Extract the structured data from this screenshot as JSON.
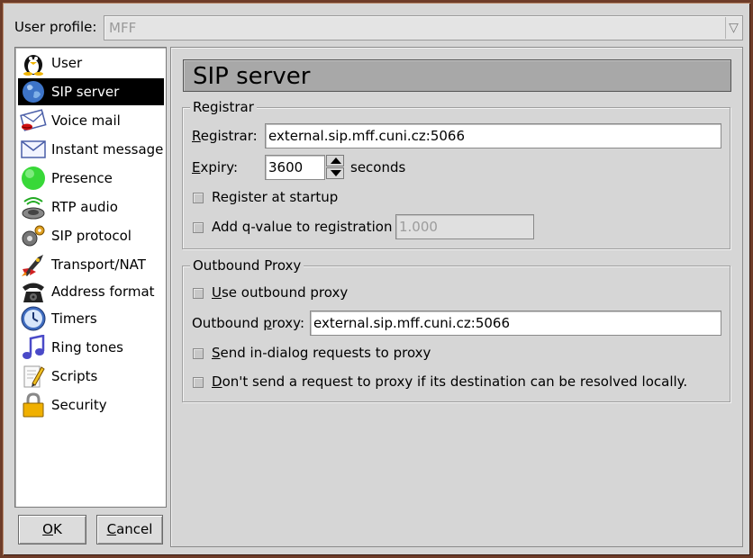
{
  "profile": {
    "label": "User profile:",
    "value": "MFF",
    "arrow": "▽"
  },
  "categories": [
    {
      "label": "User",
      "icon": "penguin-icon",
      "selected": false
    },
    {
      "label": "SIP server",
      "icon": "globe-icon",
      "selected": true
    },
    {
      "label": "Voice mail",
      "icon": "voicemail-envelope-icon",
      "selected": false
    },
    {
      "label": "Instant message",
      "icon": "envelope-icon",
      "selected": false
    },
    {
      "label": "Presence",
      "icon": "green-light-icon",
      "selected": false
    },
    {
      "label": "RTP audio",
      "icon": "speaker-icon",
      "selected": false
    },
    {
      "label": "SIP protocol",
      "icon": "gears-icon",
      "selected": false
    },
    {
      "label": "Transport/NAT",
      "icon": "rocket-icon",
      "selected": false
    },
    {
      "label": "Address format",
      "icon": "telephone-icon",
      "selected": false
    },
    {
      "label": "Timers",
      "icon": "clock-icon",
      "selected": false
    },
    {
      "label": "Ring tones",
      "icon": "music-note-icon",
      "selected": false
    },
    {
      "label": "Scripts",
      "icon": "script-pencil-icon",
      "selected": false
    },
    {
      "label": "Security",
      "icon": "padlock-icon",
      "selected": false
    }
  ],
  "buttons": {
    "ok_mnemonic": "O",
    "ok_rest": "K",
    "cancel_mnemonic": "C",
    "cancel_rest": "ancel"
  },
  "page": {
    "title": "SIP server"
  },
  "registrar_group": {
    "title": "Registrar",
    "registrar_label_mnemonic": "R",
    "registrar_label_rest": "egistrar:",
    "registrar_value": "external.sip.mff.cuni.cz:5066",
    "expiry_label_mnemonic": "E",
    "expiry_label_rest": "xpiry:",
    "expiry_value": "3600",
    "expiry_unit": "seconds",
    "register_at_startup_label": "Register at startup",
    "register_at_startup_checked": false,
    "q_value_label": "Add q-value to registration",
    "q_value_checked": false,
    "q_value": "1.000"
  },
  "proxy_group": {
    "title": "Outbound Proxy",
    "use_proxy_mnemonic": "U",
    "use_proxy_rest": "se outbound proxy",
    "use_proxy_checked": false,
    "proxy_label_pre": "Outbound ",
    "proxy_label_mnemonic": "p",
    "proxy_label_rest": "roxy:",
    "proxy_value": "external.sip.mff.cuni.cz:5066",
    "in_dialog_mnemonic": "S",
    "in_dialog_rest": "end in-dialog requests to proxy",
    "in_dialog_checked": false,
    "local_resolve_mnemonic": "D",
    "local_resolve_rest": "on't send a request to proxy if its destination can be resolved locally.",
    "local_resolve_checked": false
  },
  "colors": {
    "selection": "#000000",
    "title_bar": "#a8a8a8",
    "window_border": "#6e3c28"
  }
}
